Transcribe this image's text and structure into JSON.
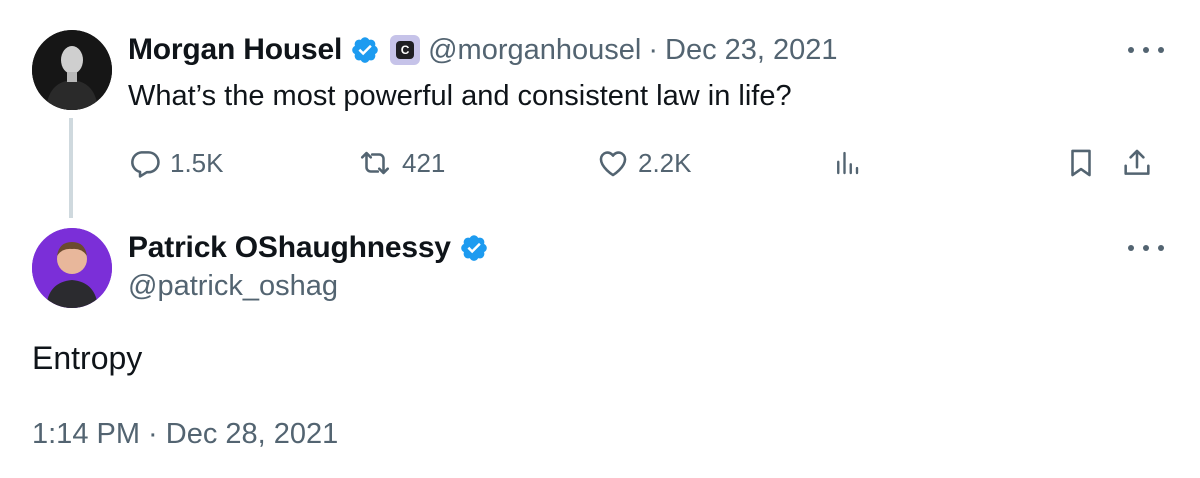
{
  "parent_tweet": {
    "author_name": "Morgan Housel",
    "handle": "@morganhousel",
    "separator": "·",
    "date": "Dec 23, 2021",
    "affiliate_badge_letter": "C",
    "text": "What’s the most powerful and consistent law in life?",
    "actions": {
      "replies": "1.5K",
      "retweets": "421",
      "likes": "2.2K"
    }
  },
  "main_tweet": {
    "author_name": "Patrick OShaughnessy",
    "handle": "@patrick_oshag",
    "text": "Entropy",
    "timestamp": "1:14 PM · Dec 28, 2021"
  },
  "colors": {
    "verified": "#1d9bf0",
    "muted_text": "#536471",
    "thread_line": "#cfd9de",
    "patrick_avatar_bg": "#7b2fd8",
    "affiliate_badge_bg": "#c6c3e9"
  },
  "icons": [
    "reply-icon",
    "retweet-icon",
    "like-icon",
    "views-icon",
    "bookmark-icon",
    "share-icon",
    "more-icon",
    "verified-badge-icon"
  ]
}
